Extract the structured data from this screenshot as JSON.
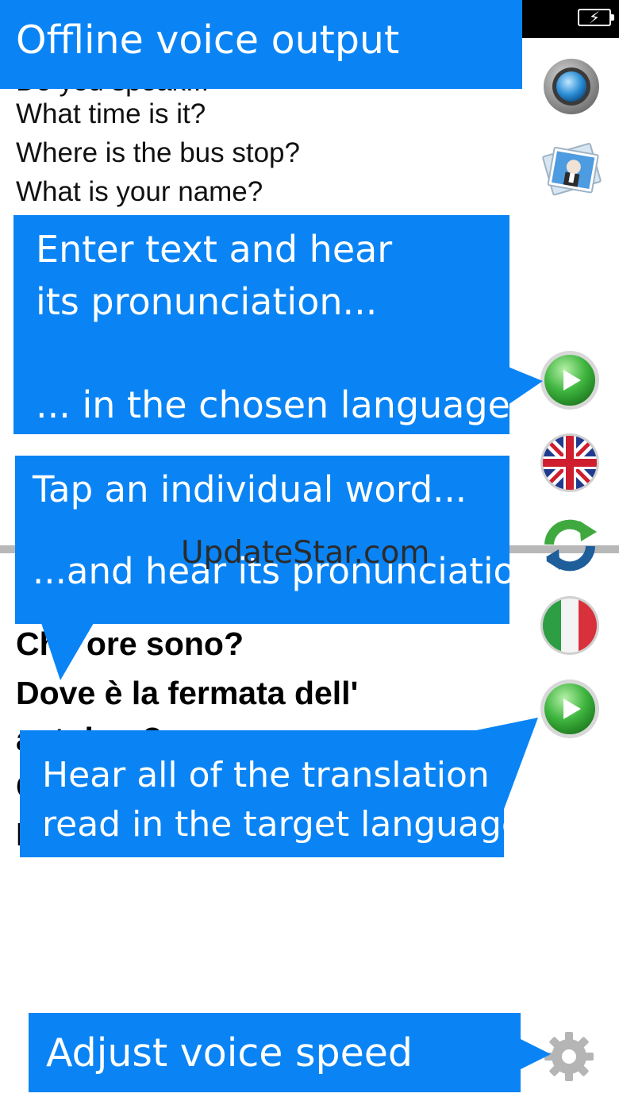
{
  "source_phrases": [
    "What time is it?",
    "Where is the bus stop?",
    "What is your name?"
  ],
  "translation_lines": [
    "Che ore sono?",
    "Dove è la fermata dell'",
    "autobus?"
  ],
  "callouts": {
    "offline": "Offline voice output",
    "enter_line1": "Enter text and hear",
    "enter_line2": "its pronunciation...",
    "enter_line3": "... in the chosen language!",
    "tap_line1": "Tap an individual word...",
    "tap_line2": "...and hear its pronunciation!",
    "hear_line1": "Hear all of the translation",
    "hear_line2": "read in the target language",
    "speed": "Adjust voice speed"
  },
  "watermark": "UpdateStar.com",
  "icons": {
    "camera": "camera-icon",
    "photos": "photos-icon",
    "play_source": "play-icon",
    "source_language": "uk-flag-icon",
    "swap": "swap-languages-icon",
    "target_language": "italy-flag-icon",
    "play_translation": "play-icon",
    "settings": "gear-icon",
    "battery": "battery-charging-icon"
  },
  "colors": {
    "callout": "#0a84f5",
    "play_green": "#3fb53f"
  }
}
